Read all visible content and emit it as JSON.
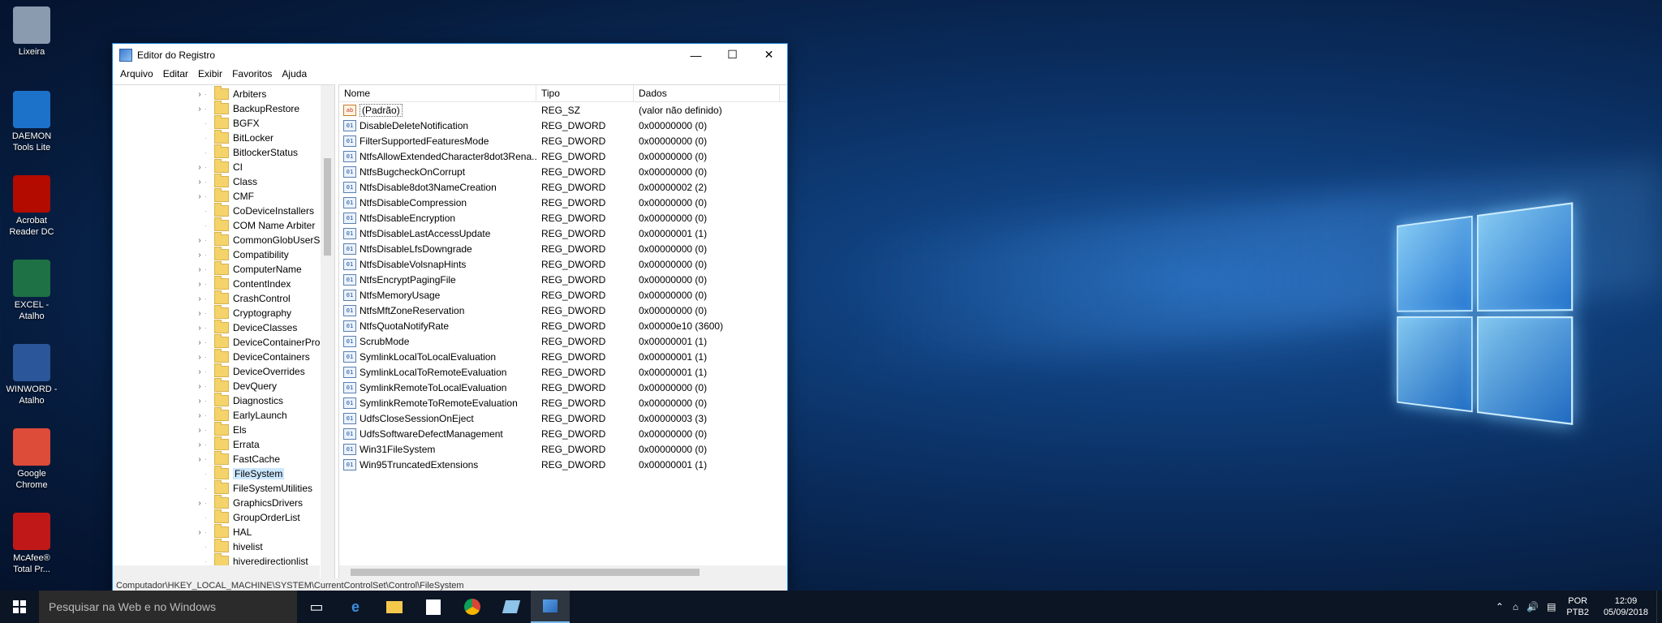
{
  "desktop": {
    "icons": [
      {
        "label1": "Lixeira",
        "label2": "",
        "color": "#8a9bb0"
      },
      {
        "label1": "DAEMON",
        "label2": "Tools Lite",
        "color": "#1c72c9"
      },
      {
        "label1": "Acrobat",
        "label2": "Reader DC",
        "color": "#b30b00"
      },
      {
        "label1": "EXCEL -",
        "label2": "Atalho",
        "color": "#1e7145"
      },
      {
        "label1": "WINWORD -",
        "label2": "Atalho",
        "color": "#2b579a"
      },
      {
        "label1": "Google",
        "label2": "Chrome",
        "color": "#dd4b39"
      },
      {
        "label1": "McAfee®",
        "label2": "Total Pr...",
        "color": "#c01818"
      }
    ]
  },
  "window": {
    "title": "Editor do Registro",
    "controls": {
      "minimize": "—",
      "maximize": "☐",
      "close": "✕"
    },
    "menu": [
      "Arquivo",
      "Editar",
      "Exibir",
      "Favoritos",
      "Ajuda"
    ],
    "tree": [
      {
        "label": "Arbiters",
        "expandable": true
      },
      {
        "label": "BackupRestore",
        "expandable": true
      },
      {
        "label": "BGFX",
        "expandable": false
      },
      {
        "label": "BitLocker",
        "expandable": false
      },
      {
        "label": "BitlockerStatus",
        "expandable": false
      },
      {
        "label": "CI",
        "expandable": true
      },
      {
        "label": "Class",
        "expandable": true
      },
      {
        "label": "CMF",
        "expandable": true
      },
      {
        "label": "CoDeviceInstallers",
        "expandable": false
      },
      {
        "label": "COM Name Arbiter",
        "expandable": false
      },
      {
        "label": "CommonGlobUserSet",
        "expandable": true
      },
      {
        "label": "Compatibility",
        "expandable": true
      },
      {
        "label": "ComputerName",
        "expandable": true
      },
      {
        "label": "ContentIndex",
        "expandable": true
      },
      {
        "label": "CrashControl",
        "expandable": true
      },
      {
        "label": "Cryptography",
        "expandable": true
      },
      {
        "label": "DeviceClasses",
        "expandable": true
      },
      {
        "label": "DeviceContainerPrope",
        "expandable": true
      },
      {
        "label": "DeviceContainers",
        "expandable": true
      },
      {
        "label": "DeviceOverrides",
        "expandable": true
      },
      {
        "label": "DevQuery",
        "expandable": true
      },
      {
        "label": "Diagnostics",
        "expandable": true
      },
      {
        "label": "EarlyLaunch",
        "expandable": true
      },
      {
        "label": "Els",
        "expandable": true
      },
      {
        "label": "Errata",
        "expandable": true
      },
      {
        "label": "FastCache",
        "expandable": true
      },
      {
        "label": "FileSystem",
        "expandable": false,
        "selected": true
      },
      {
        "label": "FileSystemUtilities",
        "expandable": false
      },
      {
        "label": "GraphicsDrivers",
        "expandable": true
      },
      {
        "label": "GroupOrderList",
        "expandable": false
      },
      {
        "label": "HAL",
        "expandable": true
      },
      {
        "label": "hivelist",
        "expandable": false
      },
      {
        "label": "hiveredirectionlist",
        "expandable": false
      }
    ],
    "columns": {
      "name": "Nome",
      "type": "Tipo",
      "data": "Dados"
    },
    "values": [
      {
        "name": "(Padrão)",
        "type": "REG_SZ",
        "data": "(valor não definido)",
        "icon": "ab"
      },
      {
        "name": "DisableDeleteNotification",
        "type": "REG_DWORD",
        "data": "0x00000000 (0)",
        "icon": "bin"
      },
      {
        "name": "FilterSupportedFeaturesMode",
        "type": "REG_DWORD",
        "data": "0x00000000 (0)",
        "icon": "bin"
      },
      {
        "name": "NtfsAllowExtendedCharacter8dot3Rena...",
        "type": "REG_DWORD",
        "data": "0x00000000 (0)",
        "icon": "bin"
      },
      {
        "name": "NtfsBugcheckOnCorrupt",
        "type": "REG_DWORD",
        "data": "0x00000000 (0)",
        "icon": "bin"
      },
      {
        "name": "NtfsDisable8dot3NameCreation",
        "type": "REG_DWORD",
        "data": "0x00000002 (2)",
        "icon": "bin"
      },
      {
        "name": "NtfsDisableCompression",
        "type": "REG_DWORD",
        "data": "0x00000000 (0)",
        "icon": "bin"
      },
      {
        "name": "NtfsDisableEncryption",
        "type": "REG_DWORD",
        "data": "0x00000000 (0)",
        "icon": "bin"
      },
      {
        "name": "NtfsDisableLastAccessUpdate",
        "type": "REG_DWORD",
        "data": "0x00000001 (1)",
        "icon": "bin"
      },
      {
        "name": "NtfsDisableLfsDowngrade",
        "type": "REG_DWORD",
        "data": "0x00000000 (0)",
        "icon": "bin"
      },
      {
        "name": "NtfsDisableVolsnapHints",
        "type": "REG_DWORD",
        "data": "0x00000000 (0)",
        "icon": "bin"
      },
      {
        "name": "NtfsEncryptPagingFile",
        "type": "REG_DWORD",
        "data": "0x00000000 (0)",
        "icon": "bin"
      },
      {
        "name": "NtfsMemoryUsage",
        "type": "REG_DWORD",
        "data": "0x00000000 (0)",
        "icon": "bin"
      },
      {
        "name": "NtfsMftZoneReservation",
        "type": "REG_DWORD",
        "data": "0x00000000 (0)",
        "icon": "bin"
      },
      {
        "name": "NtfsQuotaNotifyRate",
        "type": "REG_DWORD",
        "data": "0x00000e10 (3600)",
        "icon": "bin"
      },
      {
        "name": "ScrubMode",
        "type": "REG_DWORD",
        "data": "0x00000001 (1)",
        "icon": "bin"
      },
      {
        "name": "SymlinkLocalToLocalEvaluation",
        "type": "REG_DWORD",
        "data": "0x00000001 (1)",
        "icon": "bin"
      },
      {
        "name": "SymlinkLocalToRemoteEvaluation",
        "type": "REG_DWORD",
        "data": "0x00000001 (1)",
        "icon": "bin"
      },
      {
        "name": "SymlinkRemoteToLocalEvaluation",
        "type": "REG_DWORD",
        "data": "0x00000000 (0)",
        "icon": "bin"
      },
      {
        "name": "SymlinkRemoteToRemoteEvaluation",
        "type": "REG_DWORD",
        "data": "0x00000000 (0)",
        "icon": "bin"
      },
      {
        "name": "UdfsCloseSessionOnEject",
        "type": "REG_DWORD",
        "data": "0x00000003 (3)",
        "icon": "bin"
      },
      {
        "name": "UdfsSoftwareDefectManagement",
        "type": "REG_DWORD",
        "data": "0x00000000 (0)",
        "icon": "bin"
      },
      {
        "name": "Win31FileSystem",
        "type": "REG_DWORD",
        "data": "0x00000000 (0)",
        "icon": "bin"
      },
      {
        "name": "Win95TruncatedExtensions",
        "type": "REG_DWORD",
        "data": "0x00000001 (1)",
        "icon": "bin"
      }
    ],
    "status_path": "Computador\\HKEY_LOCAL_MACHINE\\SYSTEM\\CurrentControlSet\\Control\\FileSystem"
  },
  "taskbar": {
    "search_placeholder": "Pesquisar na Web e no Windows",
    "apps": [
      "task-view",
      "edge",
      "file-explorer",
      "store",
      "chrome",
      "regedit-files",
      "regedit"
    ],
    "tray": {
      "lang": "POR",
      "layout": "PTB2",
      "time": "12:09",
      "date": "05/09/2018"
    }
  }
}
